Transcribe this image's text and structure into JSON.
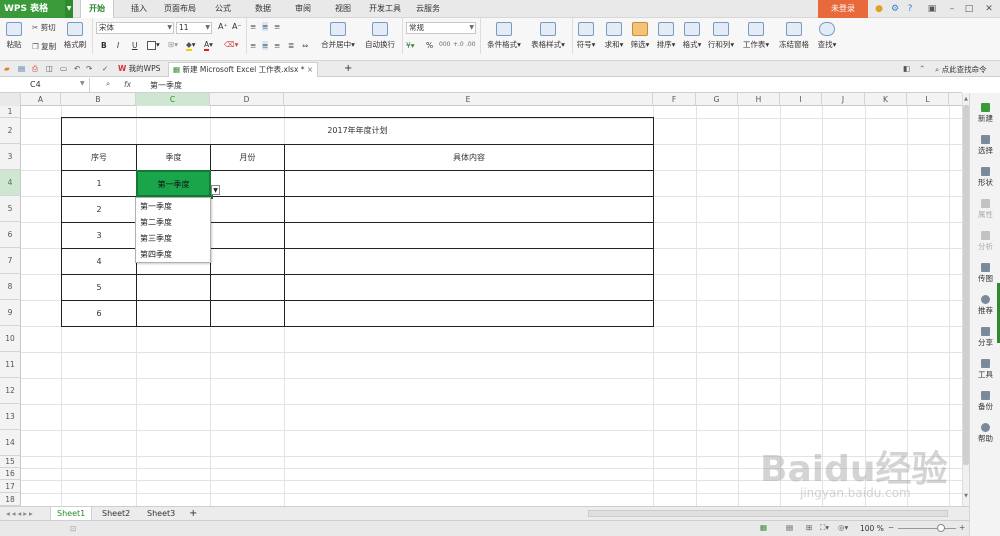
{
  "app": {
    "name": "WPS 表格",
    "login": "未登录"
  },
  "menu": [
    "开始",
    "插入",
    "页面布局",
    "公式",
    "数据",
    "审阅",
    "视图",
    "开发工具",
    "云服务"
  ],
  "ribbon": {
    "paste": "粘贴",
    "cut": "剪切",
    "copy": "复制",
    "format_painter": "格式刷",
    "font_name": "宋体",
    "font_size": "11",
    "bold": "B",
    "italic": "I",
    "underline": "U",
    "merge_center": "合并居中",
    "wrap_text": "自动换行",
    "number_format": "常规",
    "percent": "%",
    "thousands": "000",
    "conditional_format": "条件格式",
    "table_style": "表格样式",
    "symbol": "符号",
    "sum": "求和",
    "filter": "筛选",
    "sort": "排序",
    "format": "格式",
    "row_col": "行和列",
    "worksheet": "工作表",
    "freeze": "冻结窗格",
    "find": "查找"
  },
  "doc_tabs": {
    "home": "我的WPS",
    "file": "新建 Microsoft Excel 工作表.xlsx *",
    "add": "+",
    "search": "点此查找命令"
  },
  "formula_bar": {
    "cell_ref": "C4",
    "fx": "fx",
    "content": "第一季度"
  },
  "columns": [
    "A",
    "B",
    "C",
    "D",
    "E",
    "F",
    "G",
    "H",
    "I",
    "J",
    "K",
    "L"
  ],
  "rows": [
    "1",
    "2",
    "3",
    "4",
    "5",
    "6",
    "7",
    "8",
    "9",
    "10",
    "11",
    "12",
    "13",
    "14",
    "15",
    "16",
    "17",
    "18"
  ],
  "table": {
    "title": "2017年年度计划",
    "headers": [
      "序号",
      "季度",
      "月份",
      "具体内容"
    ],
    "seq": [
      "1",
      "2",
      "3",
      "4",
      "5",
      "6"
    ],
    "quarter_selected": "第一季度"
  },
  "dropdown": {
    "options": [
      "第一季度",
      "第二季度",
      "第三季度",
      "第四季度"
    ]
  },
  "right_panel": [
    "新建",
    "选择",
    "形状",
    "属性",
    "分析",
    "传图",
    "推荐",
    "分享",
    "工具",
    "备份",
    "帮助"
  ],
  "sheets": [
    "Sheet1",
    "Sheet2",
    "Sheet3"
  ],
  "sheet_add": "+",
  "status": {
    "zoom": "100 %"
  },
  "watermark": {
    "main": "Baidu经验",
    "sub": "jingyan.baidu.com"
  },
  "colors": {
    "accent": "#2d8a2d",
    "selected_cell": "#1aa54a",
    "login": "#e86a3a"
  }
}
